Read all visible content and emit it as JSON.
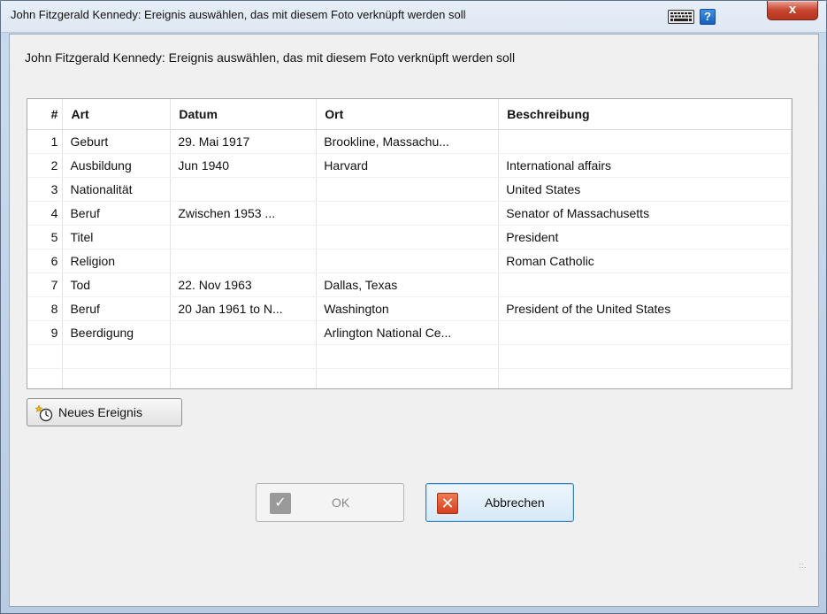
{
  "window": {
    "title": "John Fitzgerald Kennedy: Ereignis auswählen, das mit diesem Foto verknüpft werden soll",
    "close_label": "x",
    "help_label": "?"
  },
  "dialog": {
    "heading": "John Fitzgerald Kennedy: Ereignis auswählen, das mit diesem Foto verknüpft werden soll"
  },
  "table": {
    "columns": [
      "#",
      "Art",
      "Datum",
      "Ort",
      "Beschreibung"
    ],
    "rows": [
      [
        "1",
        "Geburt",
        "29. Mai 1917",
        "Brookline, Massachu...",
        ""
      ],
      [
        "2",
        "Ausbildung",
        "Jun 1940",
        "Harvard",
        "International affairs"
      ],
      [
        "3",
        "Nationalität",
        "",
        "",
        "United States"
      ],
      [
        "4",
        "Beruf",
        "Zwischen 1953 ...",
        "",
        "Senator of Massachusetts"
      ],
      [
        "5",
        "Titel",
        "",
        "",
        "President"
      ],
      [
        "6",
        "Religion",
        "",
        "",
        "Roman Catholic"
      ],
      [
        "7",
        "Tod",
        "22. Nov 1963",
        "Dallas, Texas",
        ""
      ],
      [
        "8",
        "Beruf",
        "20 Jan 1961 to N...",
        "Washington",
        "President of the United States"
      ],
      [
        "9",
        "Beerdigung",
        "",
        "Arlington National Ce...",
        ""
      ],
      [
        "",
        "",
        "",
        "",
        ""
      ],
      [
        "",
        "",
        "",
        "",
        ""
      ]
    ]
  },
  "buttons": {
    "new_event": "Neues Ereignis",
    "ok": "OK",
    "cancel": "Abbrechen"
  },
  "icons": {
    "keyboard": "keyboard-icon",
    "help": "help-icon",
    "close": "close-icon",
    "new_event": "new-event-icon",
    "ok": "checkmark-icon",
    "cancel": "cancel-x-icon"
  },
  "colors": {
    "accent_border": "#3c7fb1",
    "close_red": "#c9452f",
    "cancel_red": "#d8401f"
  }
}
